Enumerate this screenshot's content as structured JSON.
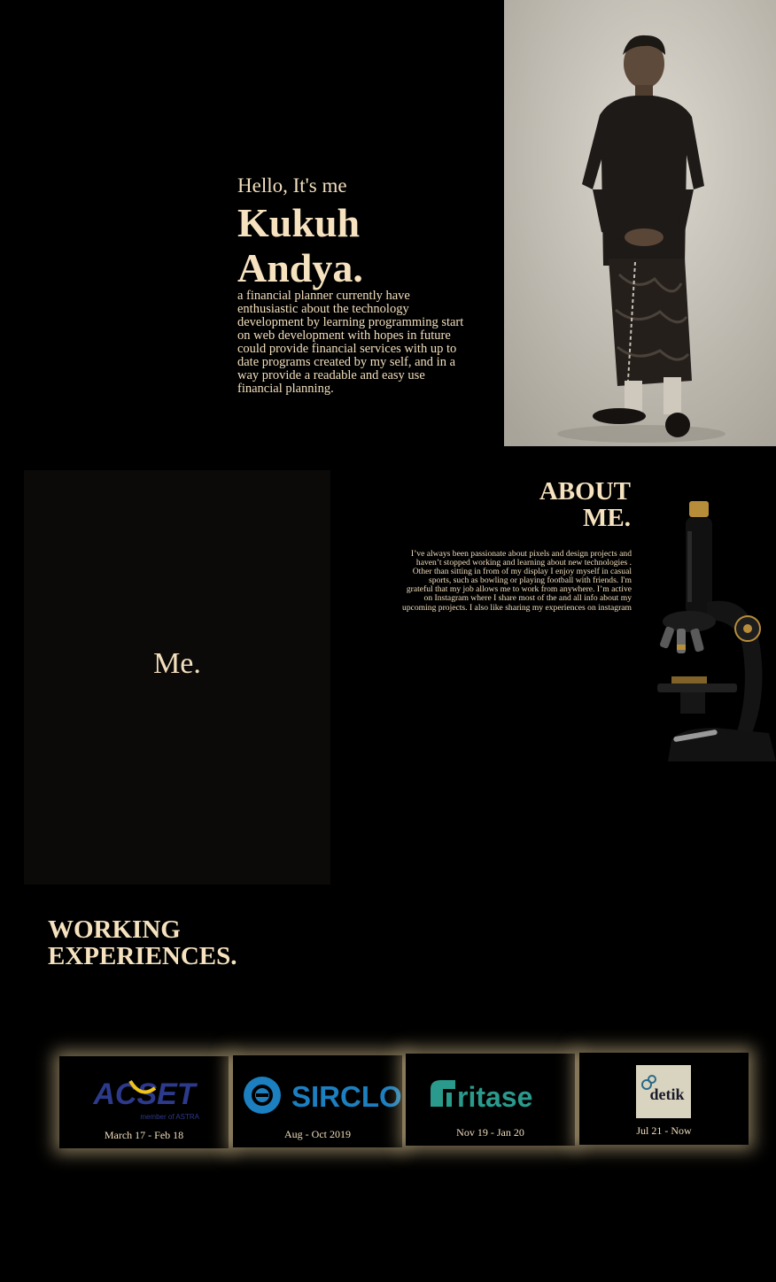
{
  "hero": {
    "greeting": "Hello, It's me",
    "name_line1": "Kukuh",
    "name_line2": "Andya.",
    "description": "a financial planner currently have enthusiastic about the technology development by learning programming start on web development with hopes in future could provide financial services with up to date programs created by my self, and in a way provide a readable and easy use financial planning."
  },
  "about": {
    "card_label": "Me.",
    "title_line1": "ABOUT",
    "title_line2": "ME.",
    "body": "I’ve always been passionate about pixels and design projects and haven’t stopped working and learning about new technologies . Other than sitting in from of my display I enjoy myself in casual sports, such as bowling or playing football with friends. I'm grateful that my job allows me to work from anywhere. I’m active on Instagram where I share most of the and all info about my upcoming projects. I also like sharing my experiences on instagram"
  },
  "work": {
    "title_line1": "WORKING",
    "title_line2": "EXPERIENCES.",
    "items": [
      {
        "logo_text": "ACSET",
        "logo_sub": "member of ASTRA",
        "date": "March 17 - Feb 18",
        "icon": "acset-logo"
      },
      {
        "logo_text": "SIRCLO",
        "date": "Aug - Oct 2019",
        "icon": "sirclo-logo"
      },
      {
        "logo_text": "ritase",
        "date": "Nov 19 - Jan 20",
        "icon": "ritase-logo"
      },
      {
        "logo_text": "detik",
        "date": "Jul 21 - Now",
        "icon": "detik-logo"
      }
    ]
  },
  "colors": {
    "background": "#000000",
    "accent_text": "#f3dfbd",
    "card_glow": "#e6cd9b",
    "sirclo_blue": "#1c7fbf",
    "ritase_teal": "#2a9a8c",
    "acset_navy": "#2d3a8c"
  }
}
